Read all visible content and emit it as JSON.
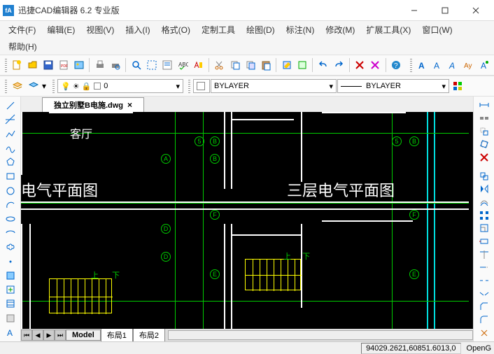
{
  "app": {
    "title": "迅捷CAD编辑器 6.2 专业版"
  },
  "window": {
    "min": "—",
    "max": "□",
    "close": "✕"
  },
  "menu": {
    "file": "文件(F)",
    "edit": "编辑(E)",
    "view": "视图(V)",
    "insert": "插入(I)",
    "format": "格式(O)",
    "custom": "定制工具",
    "draw": "绘图(D)",
    "dim": "标注(N)",
    "modify": "修改(M)",
    "ext": "扩展工具(X)",
    "window": "窗口(W)",
    "help": "帮助(H)"
  },
  "toolbar2": {
    "layer": "0",
    "linetype": "BYLAYER",
    "lineweight": "BYLAYER"
  },
  "tabs": {
    "file1": "独立别墅B电施.dwg",
    "close": "×"
  },
  "drawing": {
    "room1": "客厅",
    "title1": "电气平面图",
    "title2": "三层电气平面图",
    "up": "上",
    "down": "下"
  },
  "sheets": {
    "model": "Model",
    "layout1": "布局1",
    "layout2": "布局2"
  },
  "status": {
    "coords": "94029.2621,60851.6013,0",
    "mode": "OpenG"
  },
  "icons": {
    "new": "new",
    "open": "open",
    "save": "save",
    "print": "print"
  }
}
